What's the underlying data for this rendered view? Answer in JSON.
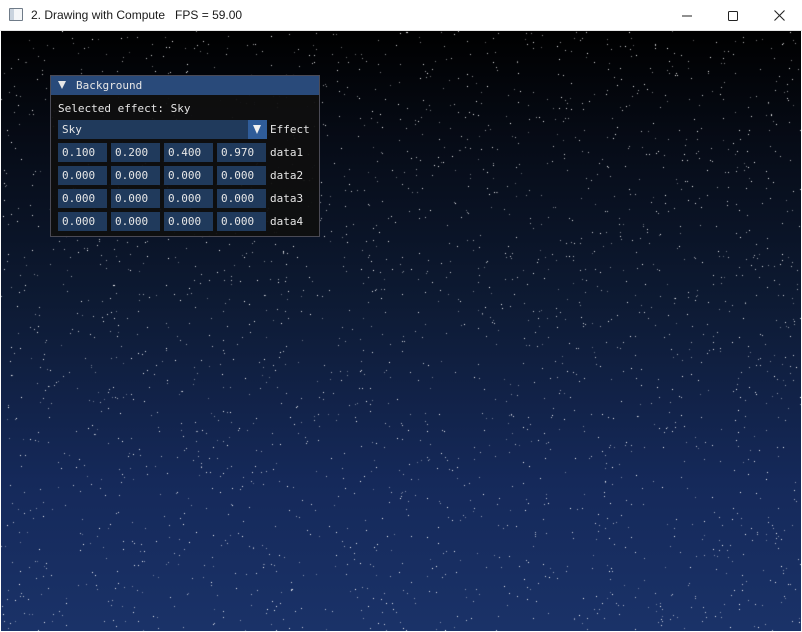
{
  "window": {
    "title": "2. Drawing with Compute   FPS = 59.00",
    "icon": "app-window-icon",
    "controls": [
      "minimize-icon",
      "maximize-icon",
      "close-icon"
    ]
  },
  "viewport": {
    "gradient_top": "#000000",
    "gradient_bottom": "#1a3268",
    "star_color": "#ffffff"
  },
  "panel": {
    "title": "Background",
    "selected_text": "Selected effect: Sky",
    "effect_combo": {
      "value": "Sky",
      "label": "Effect"
    },
    "rows": [
      {
        "label": "data1",
        "values": [
          "0.100",
          "0.200",
          "0.400",
          "0.970"
        ]
      },
      {
        "label": "data2",
        "values": [
          "0.000",
          "0.000",
          "0.000",
          "0.000"
        ]
      },
      {
        "label": "data3",
        "values": [
          "0.000",
          "0.000",
          "0.000",
          "0.000"
        ]
      },
      {
        "label": "data4",
        "values": [
          "0.000",
          "0.000",
          "0.000",
          "0.000"
        ]
      }
    ],
    "colors": {
      "header": "#294a7a",
      "frame": "#203a5c",
      "combo_button": "#2f5c99",
      "background": "#0f0f0f"
    }
  }
}
